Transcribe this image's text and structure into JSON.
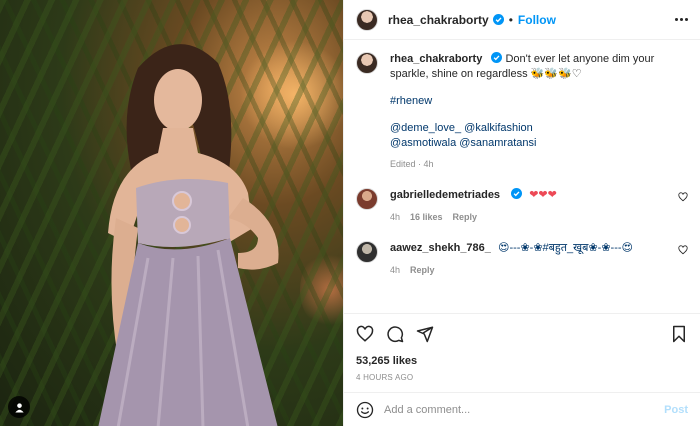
{
  "header": {
    "username": "rhea_chakraborty",
    "separator": "•",
    "follow_label": "Follow"
  },
  "caption": {
    "username": "rhea_chakraborty",
    "text": "Don't ever let anyone dim your sparkle, shine on regardless 🐝🐝🐝♡",
    "hashtag": "#rhenew",
    "mentions_line1": "@deme_love_ @kalkifashion",
    "mentions_line2": "@asmotiwala @sanamratansi",
    "meta": "Edited · 4h"
  },
  "comments": [
    {
      "username": "gabrielledemetriades",
      "text": "❤❤❤",
      "time": "4h",
      "likes": "16 likes",
      "reply": "Reply"
    },
    {
      "username": "aawez_shekh_786_",
      "text": "😍---❀-❀#बहुत_खूब❀-❀---😍",
      "time": "4h",
      "reply": "Reply"
    }
  ],
  "likes": "53,265 likes",
  "time_ago": "4 HOURS AGO",
  "add_comment": {
    "placeholder": "Add a comment...",
    "post_label": "Post"
  },
  "colors": {
    "accent": "#0095f6",
    "link": "#00376b",
    "muted": "#8e8e8e",
    "heart": "#ed4956"
  }
}
